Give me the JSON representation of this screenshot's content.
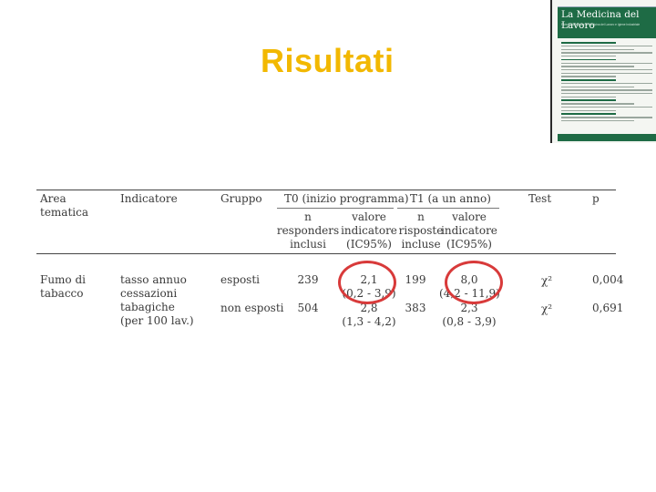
{
  "slide": {
    "title": "Risultati"
  },
  "cover": {
    "name": "La Medicina del Lavoro",
    "subtitle": "Rivista Bimestrale di Medicina del Lavoro e Igiene Industriale"
  },
  "table": {
    "headers": {
      "area": "Area tematica",
      "area_1": "Area",
      "area_2": "tematica",
      "indicator": "Indicatore",
      "group": "Gruppo",
      "t0": "T0 (inizio programma)",
      "t1": "T1 (a un anno)",
      "test": "Test",
      "p": "p",
      "t0_n": [
        "n",
        "responders",
        "inclusi"
      ],
      "t0_val": [
        "valore",
        "indicatore",
        "(IC95%)"
      ],
      "t1_n": [
        "n",
        "risposte",
        "incluse"
      ],
      "t1_val": [
        "valore",
        "indicatore",
        "(IC95%)"
      ]
    },
    "row": {
      "area": [
        "Fumo di",
        "tabacco"
      ],
      "indicator": [
        "tasso annuo",
        "cessazioni",
        "tabagiche",
        "(per 100 lav.)"
      ],
      "groups": [
        {
          "name": "esposti",
          "t0_n": "239",
          "t0_val": "2,1",
          "t0_ci": "(0,2 - 3,9)",
          "t1_n": "199",
          "t1_val": "8,0",
          "t1_ci": "(4,2 - 11,9)",
          "test": "χ²",
          "p": "0,004"
        },
        {
          "name": "non esposti",
          "t0_n": "504",
          "t0_val": "2,8",
          "t0_ci": "(1,3 - 4,2)",
          "t1_n": "383",
          "t1_val": "2,3",
          "t1_ci": "(0,8 - 3,9)",
          "test": "χ²",
          "p": "0,691"
        }
      ]
    },
    "highlight_color": "#d83a3a"
  }
}
